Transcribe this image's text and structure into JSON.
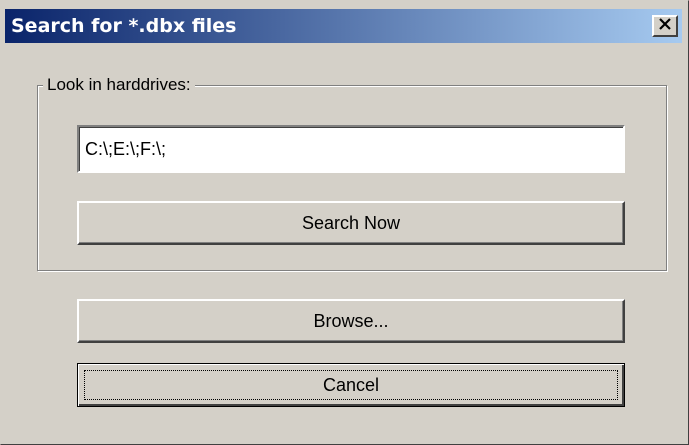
{
  "window": {
    "title": "Search for *.dbx files",
    "close_icon": "close-icon",
    "accent_color": "#0a246a"
  },
  "group": {
    "label": "Look in harddrives:",
    "path_value": "C:\\;E:\\;F:\\;",
    "search_button": "Search Now"
  },
  "buttons": {
    "browse": "Browse...",
    "cancel": "Cancel"
  }
}
